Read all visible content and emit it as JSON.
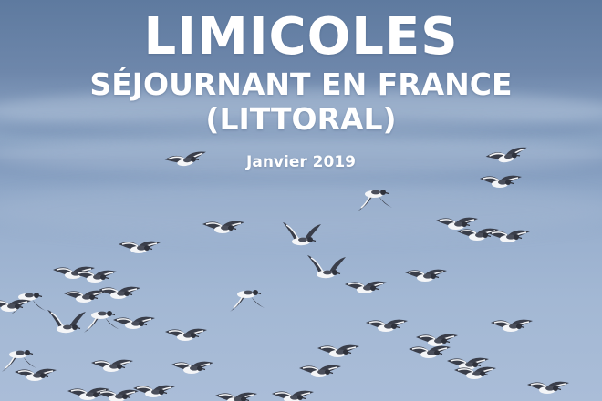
{
  "cover": {
    "title": "LIMICOLES",
    "subtitle_line1": "SÉJOURNANT EN FRANCE",
    "subtitle_line2": "(LITTORAL)",
    "date": "Janvier 2019"
  },
  "photo": {
    "subject": "flock-of-shorebirds-in-flight-over-sea",
    "colors": {
      "sky": "#5e7a9f",
      "surf": "#8ea7c6",
      "sand": "#a3b8d4",
      "bird_dark": "#3a3e4a",
      "bird_light": "#f4f5f7"
    }
  }
}
